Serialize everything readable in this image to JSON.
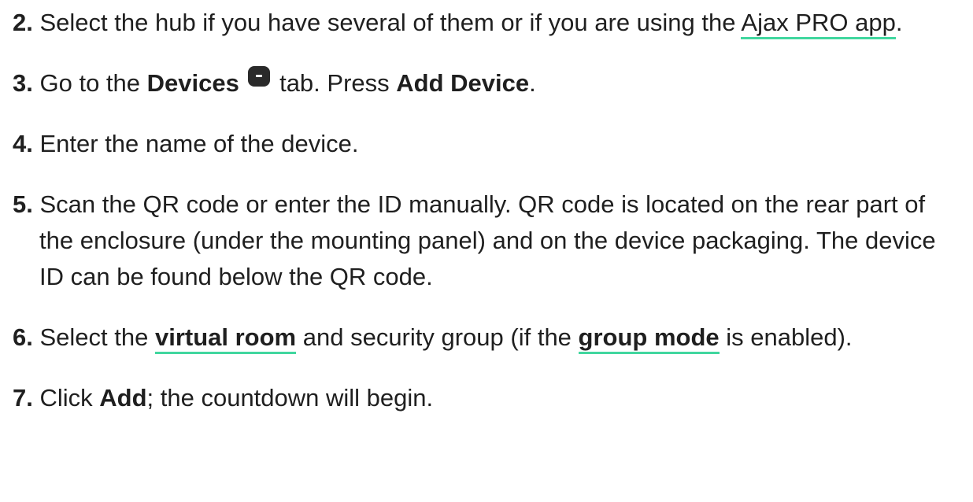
{
  "steps": [
    {
      "num": "2.",
      "parts": [
        {
          "t": "Select the hub if you have several of them or if you are using the "
        },
        {
          "t": "Ajax PRO app",
          "link": true
        },
        {
          "t": "."
        }
      ]
    },
    {
      "num": "3.",
      "parts": [
        {
          "t": "Go to the "
        },
        {
          "t": "Devices",
          "bold": true
        },
        {
          "t": " "
        },
        {
          "icon": "devices-tab-icon"
        },
        {
          "t": " tab. Press "
        },
        {
          "t": "Add Device",
          "bold": true
        },
        {
          "t": "."
        }
      ]
    },
    {
      "num": "4.",
      "parts": [
        {
          "t": "Enter the name of the device."
        }
      ]
    },
    {
      "num": "5.",
      "parts": [
        {
          "t": "Scan the QR code or enter the ID manually. QR code is located on the rear part of the enclosure (under the mounting panel) and on the device packaging. The device ID can be found below the QR code."
        }
      ]
    },
    {
      "num": "6.",
      "parts": [
        {
          "t": "Select the "
        },
        {
          "t": "virtual room",
          "link": true,
          "bold": true
        },
        {
          "t": " and security group (if the "
        },
        {
          "t": "group mode",
          "link": true,
          "bold": true
        },
        {
          "t": " is enabled)."
        }
      ]
    },
    {
      "num": "7.",
      "parts": [
        {
          "t": "Click "
        },
        {
          "t": "Add",
          "bold": true
        },
        {
          "t": "; the countdown will begin."
        }
      ]
    }
  ],
  "colors": {
    "text": "#1f1f1f",
    "link_underline": "#41d79f",
    "icon_bg": "#2a2a2a"
  }
}
